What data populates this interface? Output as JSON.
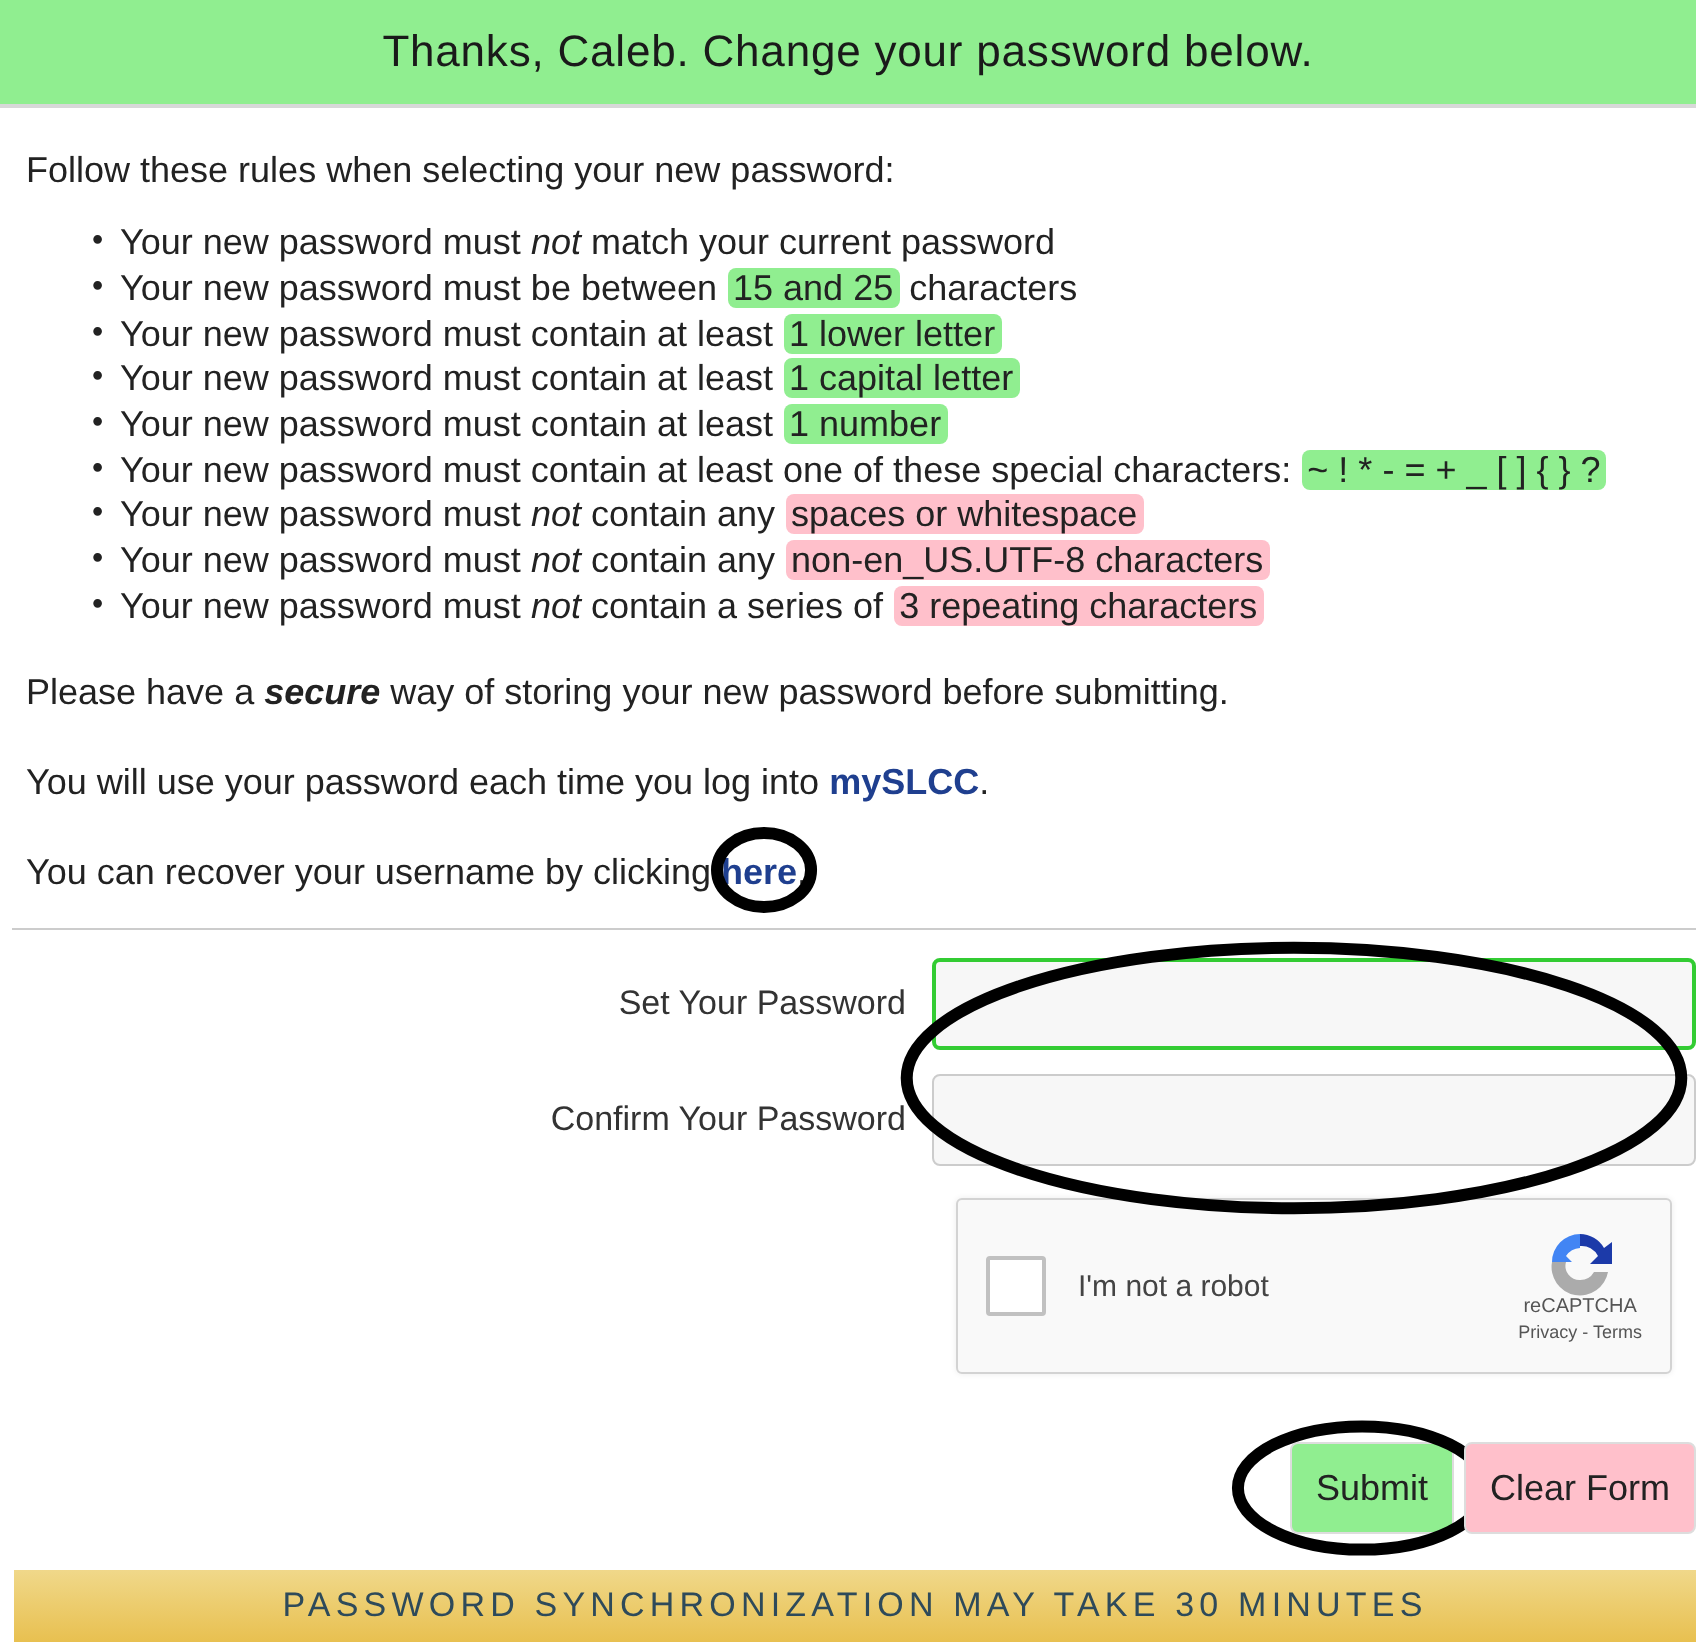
{
  "header": {
    "title": "Thanks, Caleb. Change your password below."
  },
  "intro": "Follow these rules when selecting your new password:",
  "rules": [
    {
      "bullet": "•",
      "parts": [
        {
          "text": "Your new password must *not* match your current password"
        }
      ]
    },
    {
      "bullet": "•",
      "parts": [
        {
          "text": "Your new password must be between "
        },
        {
          "text": "15 and 25",
          "color": "#90ee90"
        },
        {
          "text": " characters"
        }
      ]
    },
    {
      "bullet": "•",
      "parts": [
        {
          "text": "Your new password must contain at least "
        },
        {
          "text": "1 lower letter",
          "color": "#90ee90"
        }
      ]
    },
    {
      "bullet": "•",
      "parts": [
        {
          "text": "Your new password must contain at least "
        },
        {
          "text": "1 capital letter",
          "color": "#90ee90"
        }
      ]
    },
    {
      "bullet": "•",
      "parts": [
        {
          "text": "Your new password must contain at least "
        },
        {
          "text": "1 number",
          "color": "#90ee90"
        }
      ]
    },
    {
      "bullet": "•",
      "parts": [
        {
          "text": "Your new password must contain at least one of these special characters: "
        },
        {
          "text": "~ ! * - = + _ [ ] { } ?",
          "color": "#90ee90"
        }
      ]
    },
    {
      "bullet": "•",
      "parts": [
        {
          "text": "Your new password must *not* contain any "
        },
        {
          "text": "spaces or whitespace",
          "color": "#ffc0cb"
        }
      ]
    },
    {
      "bullet": "•",
      "parts": [
        {
          "text": "Your new password must *not* contain any "
        },
        {
          "text": "non-en_US.UTF-8 characters",
          "color": "#ffc0cb"
        }
      ]
    },
    {
      "bullet": "•",
      "parts": [
        {
          "text": "Your new password must *not* contain a series of "
        },
        {
          "text": "3 repeating characters",
          "color": "#ffc0cb"
        }
      ]
    }
  ],
  "notes": [
    {
      "text": "Please have a **secure** way of storing your new password before submitting."
    },
    {
      "text": "You will use your password each time you log into ",
      "link": "mySLCC",
      "after": ".",
      "link_circled": false
    },
    {
      "text": "You can recover your username by clicking ",
      "link": "here",
      "after": ".",
      "link_circled": true
    }
  ],
  "form": {
    "fields_circled": true,
    "fields": [
      {
        "label": "Set Your Password",
        "focused": true
      },
      {
        "label": "Confirm Your Password",
        "focused": false
      }
    ],
    "captcha": {
      "label": "I'm not a robot",
      "checked": false,
      "brand": "reCAPTCHA",
      "privacy": "Privacy",
      "separator": " - ",
      "terms": "Terms"
    },
    "buttons": [
      {
        "label": "Submit",
        "kind": "submit",
        "circled": true
      },
      {
        "label": "Clear Form",
        "kind": "reset",
        "circled": false
      }
    ]
  },
  "footer": "PASSWORD SYNCHRONIZATION MAY TAKE 30 MINUTES"
}
